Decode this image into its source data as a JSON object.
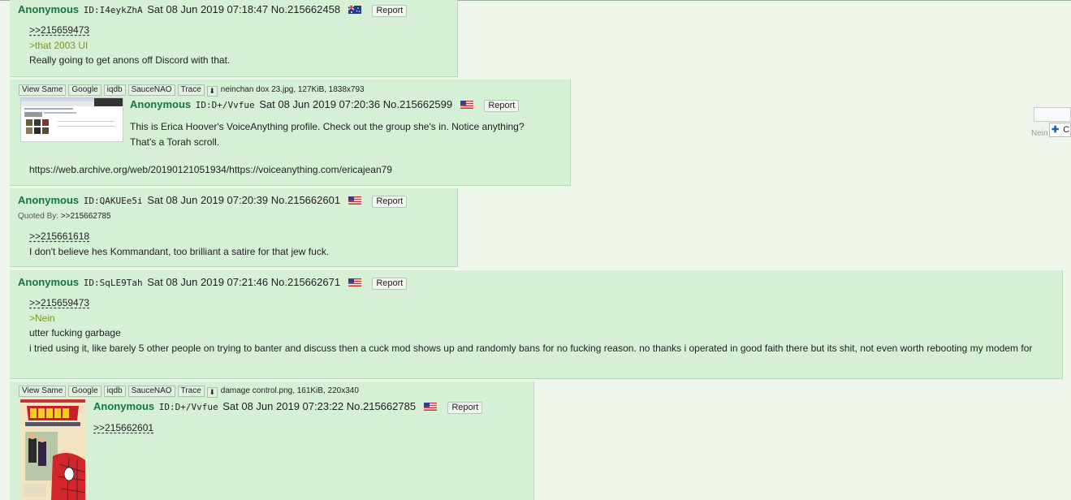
{
  "common": {
    "report_label": "Report",
    "toolbar": [
      "View Same",
      "Google",
      "iqdb",
      "SauceNAO",
      "Trace"
    ]
  },
  "posts": [
    {
      "name": "Anonymous",
      "id": "ID:I4eykZhA",
      "date": "Sat 08 Jun 2019 07:18:47",
      "no": "No.215662458",
      "flag": "au",
      "lines": [
        {
          "type": "quotelink",
          "text": ">>215659473"
        },
        {
          "type": "greentext",
          "text": ">that 2003 UI"
        },
        {
          "type": "text",
          "text": "Really going to get anons off Discord with that."
        }
      ]
    },
    {
      "name": "Anonymous",
      "id": "ID:D+/Vvfue",
      "date": "Sat 08 Jun 2019 07:20:36",
      "no": "No.215662599",
      "flag": "us",
      "file": "neinchan dox 23.jpg, 127KiB, 1838x793",
      "lines": [
        {
          "type": "text",
          "text": "This is Erica Hoover's VoiceAnything profile. Check out the group she's in. Notice anything?"
        },
        {
          "type": "text",
          "text": "That's a Torah scroll."
        },
        {
          "type": "blank",
          "text": ""
        },
        {
          "type": "text",
          "text": "https://web.archive.org/web/20190121051934/https://voiceanything.com/ericajean79"
        }
      ]
    },
    {
      "name": "Anonymous",
      "id": "ID:QAKUEe5i",
      "date": "Sat 08 Jun 2019 07:20:39",
      "no": "No.215662601",
      "flag": "us",
      "quoted_by_label": "Quoted By:",
      "quoted_by": ">>215662785",
      "lines": [
        {
          "type": "quotelink",
          "text": ">>215661618"
        },
        {
          "type": "text",
          "text": "I don't believe hes Kommandant, too brilliant a satire for that jew fuck."
        }
      ]
    },
    {
      "name": "Anonymous",
      "id": "ID:SqLE9Tah",
      "date": "Sat 08 Jun 2019 07:21:46",
      "no": "No.215662671",
      "flag": "us",
      "lines": [
        {
          "type": "quotelink",
          "text": ">>215659473"
        },
        {
          "type": "greentext",
          "text": ">Nein"
        },
        {
          "type": "text",
          "text": "utter fucking garbage"
        },
        {
          "type": "wrap",
          "text": "i tried using it, like barely 5 other people on trying to banter and discuss then a cuck mod shows up and randomly bans for no fucking reason. no thanks i operated in good faith there but its shit, not even worth rebooting my modem for"
        }
      ]
    },
    {
      "name": "Anonymous",
      "id": "ID:D+/Vvfue",
      "date": "Sat 08 Jun 2019 07:23:22",
      "no": "No.215662785",
      "flag": "us",
      "file": "damage control.png, 161KiB, 220x340",
      "lines": [
        {
          "type": "quotelink",
          "text": ">>215662601"
        }
      ]
    }
  ],
  "corner_widget": {
    "label_partial": "Nein",
    "button_partial": "C",
    "icon": "plus-icon"
  },
  "colors": {
    "page_bg": "#eef6ec",
    "post_bg": "#d6f0d6",
    "name": "#117743",
    "greentext": "#789922"
  }
}
